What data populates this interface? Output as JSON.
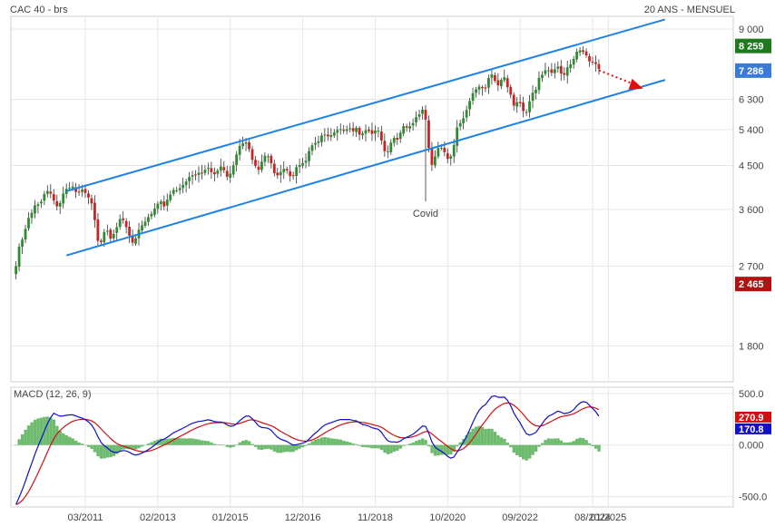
{
  "chart_data": {
    "title": "CAC 40 - brs",
    "subtitle": "20 ANS - MENSUEL",
    "type": "candlestick",
    "price_axis": {
      "scale": "log",
      "range": [
        1500,
        9600
      ],
      "ticks": [
        1800,
        2700,
        3600,
        4500,
        5400,
        6300,
        9000
      ],
      "tick_labels": [
        "1 800",
        "2 700",
        "3 600",
        "4 500",
        "5 400",
        "6 300",
        "9 000"
      ]
    },
    "x_axis": {
      "range": [
        "2009-05",
        "2027-01"
      ],
      "ticks": [
        "2011-03",
        "2013-02",
        "2015-01",
        "2016-12",
        "2018-11",
        "2020-10",
        "2022-09",
        "2024-08",
        "2025-01"
      ],
      "tick_labels": [
        "03/2011",
        "02/2013",
        "01/2015",
        "12/2016",
        "11/2018",
        "10/2020",
        "09/2022",
        "08/2024",
        "01/2025"
      ]
    },
    "grid": true,
    "badges": [
      {
        "label": "8 259",
        "value": 8259,
        "color": "#1f7a1f"
      },
      {
        "label": "7 286",
        "value": 7286,
        "color": "#3a7bd5"
      },
      {
        "label": "2 465",
        "value": 2465,
        "color": "#b01212"
      }
    ],
    "annotations": [
      {
        "text": "Covid",
        "date": "2020-03",
        "color": "#d01010"
      }
    ],
    "trend_channel": {
      "color": "#1e82e6",
      "upper": {
        "from": [
          "2010-09",
          3950
        ],
        "to": [
          "2026-07",
          9450
        ]
      },
      "lower": {
        "from": [
          "2010-09",
          2850
        ],
        "to": [
          "2026-07",
          6950
        ]
      },
      "projection_arrow": {
        "from": [
          "2024-10",
          7300
        ],
        "to": [
          "2025-12",
          6650
        ],
        "color": "#e01010"
      }
    },
    "monthly_closes": [
      2700,
      3000,
      3100,
      3300,
      3500,
      3560,
      3750,
      3650,
      3850,
      3960,
      3940,
      3800,
      3650,
      3700,
      3900,
      4000,
      4020,
      4050,
      3900,
      3950,
      4000,
      3850,
      3800,
      3600,
      3100,
      3000,
      3200,
      3250,
      3100,
      3180,
      3300,
      3450,
      3400,
      3250,
      3100,
      3000,
      3200,
      3300,
      3350,
      3450,
      3500,
      3600,
      3700,
      3750,
      3650,
      3800,
      3900,
      4000,
      3950,
      4050,
      4100,
      4200,
      4300,
      4250,
      4350,
      4300,
      4400,
      4450,
      4350,
      4300,
      4400,
      4500,
      4350,
      4200,
      4400,
      4600,
      4950,
      5000,
      5100,
      4950,
      4650,
      4500,
      4400,
      4600,
      4750,
      4700,
      4500,
      4250,
      4300,
      4400,
      4450,
      4300,
      4200,
      4450,
      4500,
      4550,
      4600,
      4850,
      5000,
      5050,
      5100,
      5300,
      5250,
      5200,
      5300,
      5350,
      5450,
      5350,
      5400,
      5450,
      5350,
      5450,
      5250,
      5300,
      5400,
      5350,
      5250,
      5450,
      5300,
      4900,
      4750,
      5000,
      5200,
      5100,
      5300,
      5500,
      5450,
      5500,
      5600,
      5800,
      5850,
      6050,
      5400,
      4450,
      4600,
      4900,
      4950,
      4850,
      4650,
      4700,
      5000,
      5500,
      5600,
      5750,
      6050,
      6350,
      6600,
      6650,
      6800,
      6500,
      6950,
      7200,
      6950,
      6750,
      6950,
      7050,
      6650,
      6400,
      6000,
      6300,
      6100,
      5800,
      6000,
      6550,
      6450,
      7000,
      7100,
      7300,
      7300,
      7200,
      7350,
      7450,
      7100,
      7150,
      7550,
      7500,
      7950,
      8100,
      8050,
      7950,
      7650,
      7600,
      7550,
      7350
    ],
    "covid_low": 3750,
    "macd": {
      "label": "MACD (12, 26, 9)",
      "range": [
        -600,
        560
      ],
      "ticks": [
        500,
        0,
        -500
      ],
      "tick_labels": [
        "500.0",
        "0.000",
        "-500.0"
      ],
      "macd_value": 170.8,
      "signal_value": 270.9,
      "macd_color": "#1010c8",
      "signal_color": "#d01010",
      "histogram_color": "#3ea33e"
    }
  }
}
